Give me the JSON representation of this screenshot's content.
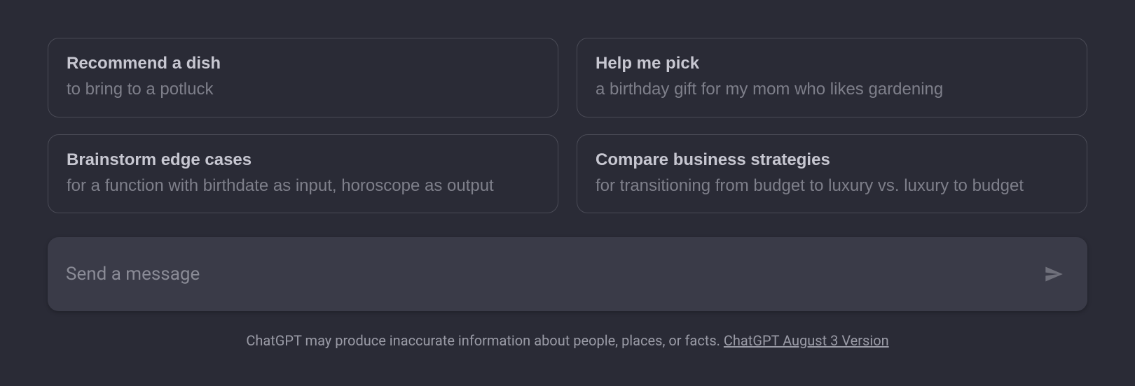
{
  "suggestions": [
    {
      "title": "Recommend a dish",
      "subtitle": "to bring to a potluck"
    },
    {
      "title": "Help me pick",
      "subtitle": "a birthday gift for my mom who likes gardening"
    },
    {
      "title": "Brainstorm edge cases",
      "subtitle": "for a function with birthdate as input, horoscope as output"
    },
    {
      "title": "Compare business strategies",
      "subtitle": "for transitioning from budget to luxury vs. luxury to budget"
    }
  ],
  "input": {
    "placeholder": "Send a message",
    "value": ""
  },
  "footer": {
    "text": "ChatGPT may produce inaccurate information about people, places, or facts. ",
    "link_text": "ChatGPT August 3 Version"
  }
}
